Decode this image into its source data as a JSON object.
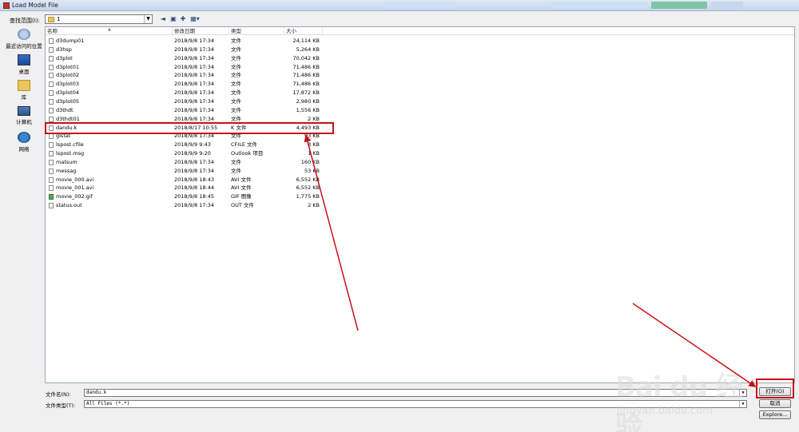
{
  "window": {
    "title": "Load Model File"
  },
  "lookin": {
    "label": "查找范围(I):",
    "value": "1"
  },
  "places": [
    {
      "label": "最近访问的位置",
      "icon": "recent-places-icon"
    },
    {
      "label": "桌面",
      "icon": "desktop-icon"
    },
    {
      "label": "库",
      "icon": "libraries-icon"
    },
    {
      "label": "计算机",
      "icon": "computer-icon"
    },
    {
      "label": "网络",
      "icon": "network-icon"
    }
  ],
  "columns": {
    "name": "名称",
    "date": "修改日期",
    "type": "类型",
    "size": "大小"
  },
  "files": [
    {
      "name": "d3dump01",
      "date": "2018/9/8 17:34",
      "type": "文件",
      "size": "24,114 KB"
    },
    {
      "name": "d3hsp",
      "date": "2018/9/8 17:34",
      "type": "文件",
      "size": "5,264 KB"
    },
    {
      "name": "d3plot",
      "date": "2018/9/8 17:34",
      "type": "文件",
      "size": "70,042 KB"
    },
    {
      "name": "d3plot01",
      "date": "2018/9/8 17:34",
      "type": "文件",
      "size": "71,486 KB"
    },
    {
      "name": "d3plot02",
      "date": "2018/9/8 17:34",
      "type": "文件",
      "size": "71,486 KB"
    },
    {
      "name": "d3plot03",
      "date": "2018/9/8 17:34",
      "type": "文件",
      "size": "71,486 KB"
    },
    {
      "name": "d3plot04",
      "date": "2018/9/8 17:34",
      "type": "文件",
      "size": "17,872 KB"
    },
    {
      "name": "d3plot05",
      "date": "2018/9/8 17:34",
      "type": "文件",
      "size": "2,980 KB"
    },
    {
      "name": "d3thdt",
      "date": "2018/9/8 17:34",
      "type": "文件",
      "size": "1,556 KB"
    },
    {
      "name": "d3thdt01",
      "date": "2018/9/8 17:34",
      "type": "文件",
      "size": "2 KB"
    },
    {
      "name": "dandu.k",
      "date": "2018/8/17 10:55",
      "type": "K 文件",
      "size": "4,493 KB"
    },
    {
      "name": "glstat",
      "date": "2018/9/8 17:34",
      "type": "文件",
      "size": "93 KB"
    },
    {
      "name": "lspost.cfile",
      "date": "2018/9/9 9:43",
      "type": "CFILE 文件",
      "size": "3 KB"
    },
    {
      "name": "lspost.msg",
      "date": "2018/9/9 9:20",
      "type": "Outlook 项目",
      "size": "1 KB"
    },
    {
      "name": "matsum",
      "date": "2018/9/8 17:34",
      "type": "文件",
      "size": "160 KB"
    },
    {
      "name": "messag",
      "date": "2018/9/8 17:34",
      "type": "文件",
      "size": "53 KB"
    },
    {
      "name": "movie_000.avi",
      "date": "2018/9/8 18:43",
      "type": "AVI 文件",
      "size": "6,552 KB"
    },
    {
      "name": "movie_001.avi",
      "date": "2018/9/8 18:44",
      "type": "AVI 文件",
      "size": "6,552 KB"
    },
    {
      "name": "movie_002.gif",
      "date": "2018/9/8 18:45",
      "type": "GIF 图像",
      "size": "1,775 KB"
    },
    {
      "name": "status.out",
      "date": "2018/9/8 17:34",
      "type": "OUT 文件",
      "size": "2 KB"
    }
  ],
  "filename": {
    "label": "文件名(N):",
    "value": "dandu.k"
  },
  "filetype": {
    "label": "文件类型(T):",
    "value": "All Files (*.*)"
  },
  "buttons": {
    "open": "打开(O)",
    "cancel": "取消",
    "explore": "Explore..."
  },
  "watermark": {
    "logo": "Bai du 经验",
    "url": "jingyan.baidu.com"
  },
  "annotation": {
    "color": "#c8101a"
  }
}
